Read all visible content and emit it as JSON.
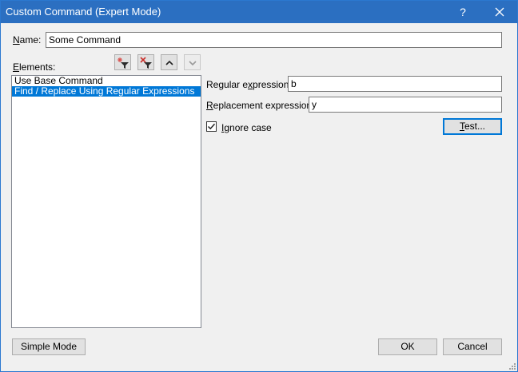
{
  "window": {
    "title": "Custom Command (Expert Mode)",
    "help_glyph": "?"
  },
  "name": {
    "label": "Name:",
    "value": "Some Command"
  },
  "elements": {
    "label": "Elements:",
    "toolbar": {
      "add_icon": "add-filter-icon",
      "remove_icon": "remove-filter-icon",
      "up_icon": "chevron-up-icon",
      "down_icon": "chevron-down-icon"
    },
    "items": [
      {
        "label": "Use Base Command",
        "selected": false
      },
      {
        "label": "Find / Replace Using Regular Expressions",
        "selected": true
      }
    ]
  },
  "details": {
    "regex_label": "Regular expression:",
    "regex_value": "b",
    "replacement_label": "Replacement expression:",
    "replacement_value": "y",
    "ignore_case_label": "Ignore case",
    "ignore_case_checked": true,
    "test_button": "Test..."
  },
  "footer": {
    "simple_mode_button": "Simple Mode",
    "ok_button": "OK",
    "cancel_button": "Cancel"
  },
  "colors": {
    "titlebar": "#2b6fc1",
    "selection": "#0078d7",
    "focus_border": "#0078d7"
  }
}
